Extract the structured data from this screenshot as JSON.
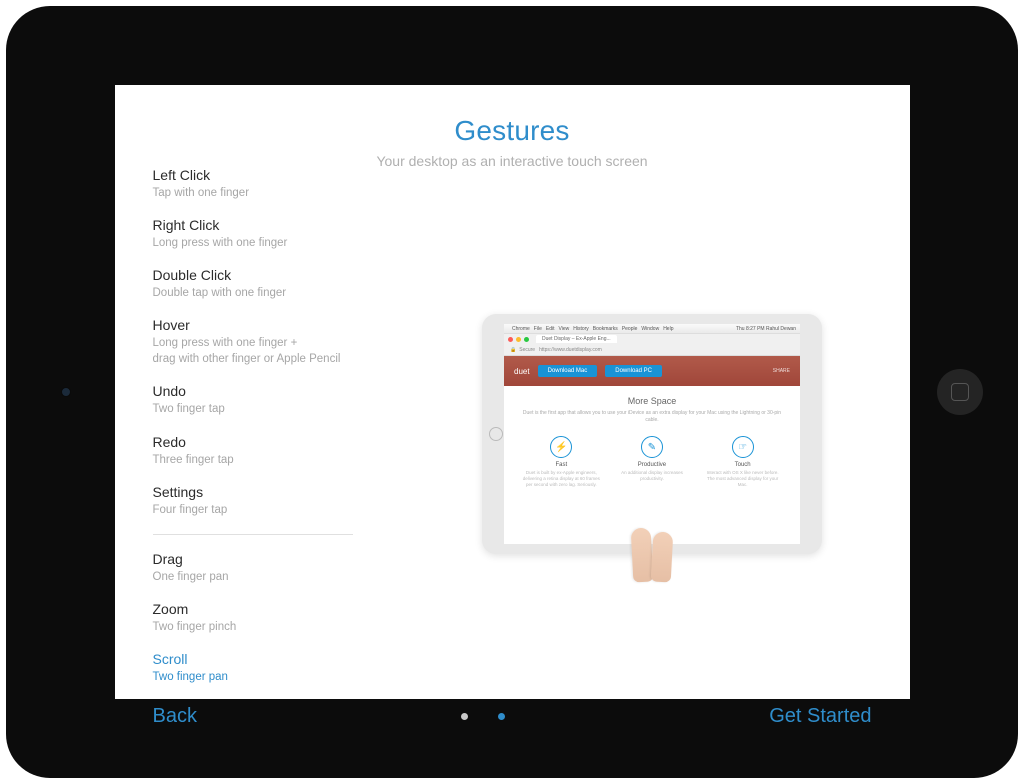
{
  "header": {
    "title": "Gestures",
    "subtitle": "Your desktop as an interactive touch screen"
  },
  "gestures": [
    {
      "name": "Left Click",
      "desc": "Tap with one finger"
    },
    {
      "name": "Right Click",
      "desc": "Long press with one finger"
    },
    {
      "name": "Double Click",
      "desc": "Double tap with one finger"
    },
    {
      "name": "Hover",
      "desc": "Long press with one finger +\ndrag with other finger or Apple Pencil"
    },
    {
      "name": "Undo",
      "desc": "Two finger tap"
    },
    {
      "name": "Redo",
      "desc": "Three finger tap"
    },
    {
      "name": "Settings",
      "desc": "Four finger tap"
    },
    {
      "name": "Drag",
      "desc": "One finger pan"
    },
    {
      "name": "Zoom",
      "desc": "Two finger pinch"
    },
    {
      "name": "Scroll",
      "desc": "Two finger pan"
    }
  ],
  "active_gesture_index": 9,
  "divider_after_index": 6,
  "illustration": {
    "menubar_items": [
      "Chrome",
      "File",
      "Edit",
      "View",
      "History",
      "Bookmarks",
      "People",
      "Window",
      "Help"
    ],
    "status_right": "Thu 8:27 PM  Rahul Dewan",
    "tab_label": "Duet Display – Ex-Apple Eng...",
    "url_secure_label": "Secure",
    "url": "https://www.duetdisplay.com",
    "brand": "duet",
    "download_mac": "Download Mac",
    "download_pc": "Download PC",
    "share_label": "SHARE",
    "more_space_title": "More Space",
    "more_space_sub": "Duet is the first app that allows you to use your iDevice as an extra display for your Mac using the Lightning or 30-pin cable.",
    "features": [
      {
        "icon": "⚡",
        "label": "Fast",
        "desc": "Duet is built by ex-Apple engineers, delivering a retina display at 60 frames per second with zero lag. Seriously."
      },
      {
        "icon": "✎",
        "label": "Productive",
        "desc": "An additional display increases productivity."
      },
      {
        "icon": "☞",
        "label": "Touch",
        "desc": "Interact with OS X like never before. The most advanced display for your Mac."
      }
    ]
  },
  "footer": {
    "back": "Back",
    "next": "Get Started",
    "page_count": 2,
    "active_page": 1
  },
  "colors": {
    "accent": "#2f8dcb"
  }
}
